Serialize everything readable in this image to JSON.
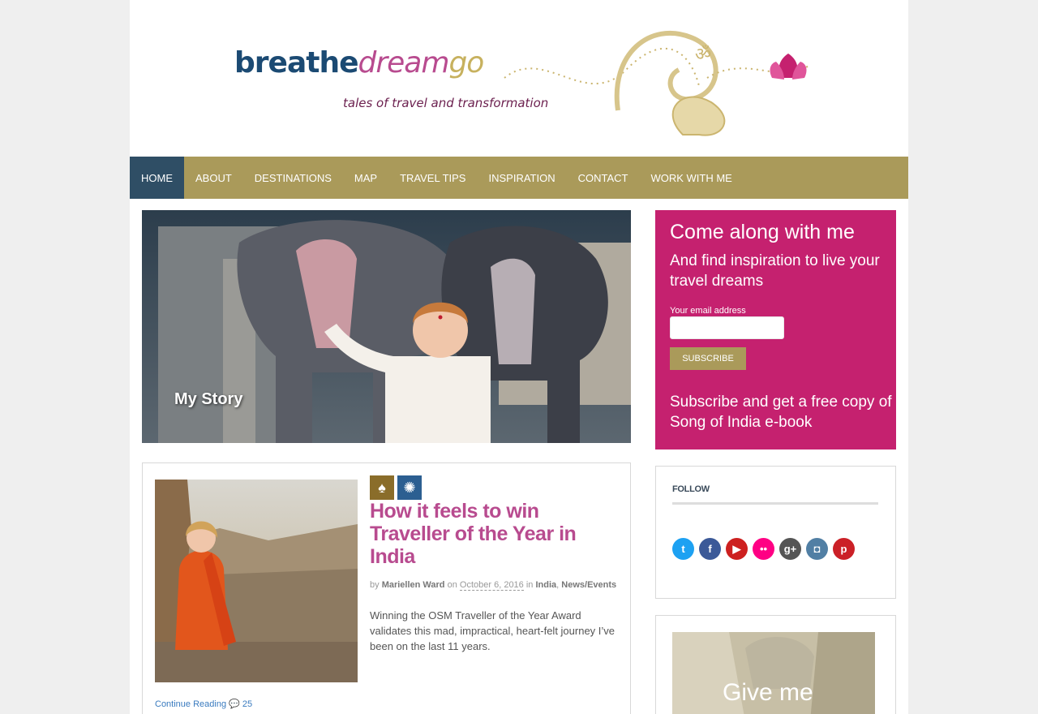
{
  "site": {
    "logo": {
      "part1": "breathe",
      "part2": "dream",
      "part3": "go"
    },
    "tagline": "tales of travel and transformation"
  },
  "nav": {
    "items": [
      "HOME",
      "ABOUT",
      "DESTINATIONS",
      "MAP",
      "TRAVEL TIPS",
      "INSPIRATION",
      "CONTACT",
      "WORK WITH ME"
    ],
    "active": "HOME"
  },
  "hero": {
    "caption": "My Story"
  },
  "post": {
    "title": "How it feels to win Traveller of the Year in India",
    "author_prefix": "by",
    "author": "Mariellen Ward",
    "on": "on",
    "date": "October 6, 2016",
    "in": "in",
    "category1": "India",
    "category2": "News/Events",
    "excerpt": "Winning the OSM Traveller of the Year Award validates this mad, impractical, heart-felt journey I’ve been on the last 11 years.",
    "continue_label": "Continue Reading",
    "comment_count": "25",
    "category_icons": [
      "ganesh-icon",
      "mandala-icon"
    ]
  },
  "subscribe": {
    "title": "Come along with me",
    "subtitle": "And find inspiration to live your travel dreams",
    "email_label": "Your email address",
    "email_value": "",
    "button_label": "Subscribe",
    "offer": "Subscribe and get a free copy of Song of India e-book"
  },
  "follow": {
    "title": "FOLLOW",
    "networks": [
      {
        "name": "twitter-icon",
        "glyph": "t",
        "color": "#1da1f2"
      },
      {
        "name": "facebook-icon",
        "glyph": "f",
        "color": "#3b5998"
      },
      {
        "name": "youtube-icon",
        "glyph": "▶",
        "color": "#cd201f"
      },
      {
        "name": "flickr-icon",
        "glyph": "••",
        "color": "#ff0084"
      },
      {
        "name": "google-plus-icon",
        "glyph": "g+",
        "color": "#555555"
      },
      {
        "name": "instagram-icon",
        "glyph": "◘",
        "color": "#517fa4"
      },
      {
        "name": "pinterest-icon",
        "glyph": "p",
        "color": "#cb2027"
      }
    ]
  },
  "promo": {
    "text": "Give me"
  },
  "colors": {
    "accent_pink": "#c5216f",
    "nav_gold": "#aa9a5a",
    "nav_active": "#2f4e65"
  }
}
